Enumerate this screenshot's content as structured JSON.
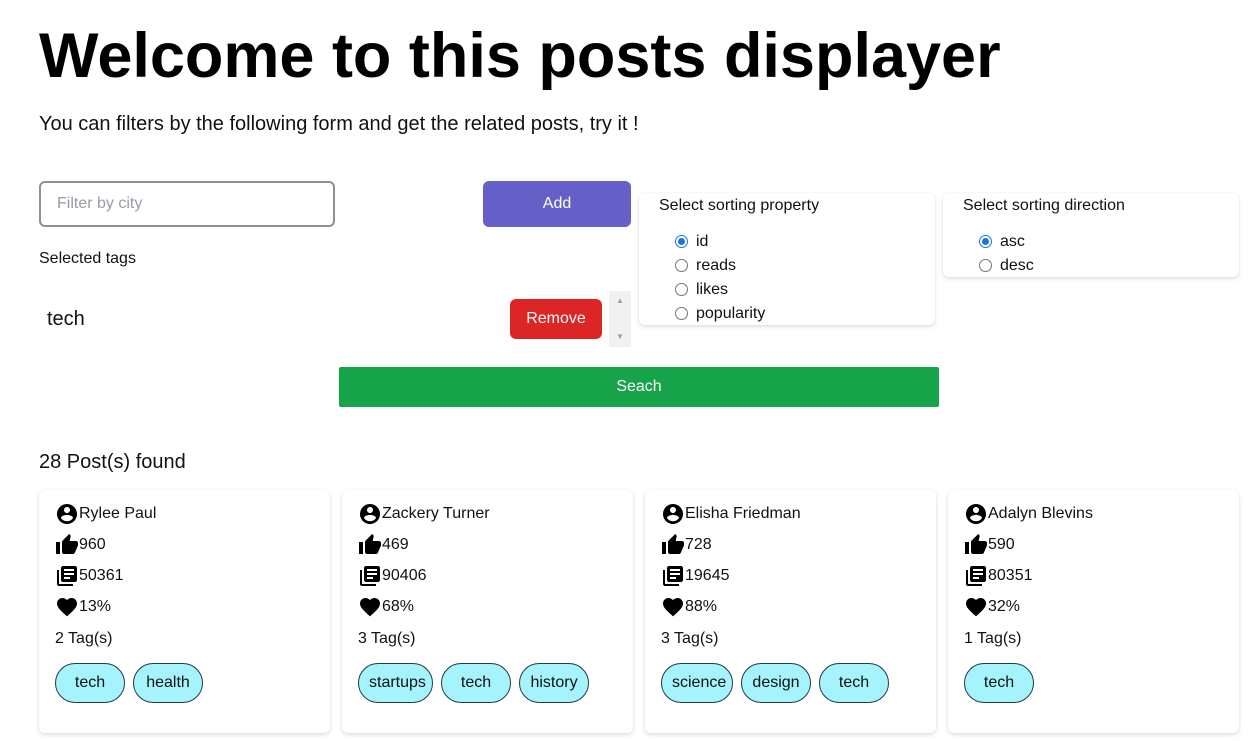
{
  "header": {
    "title": "Welcome to this posts displayer",
    "subtitle": "You can filters by the following form and get the related posts, try it !"
  },
  "filter": {
    "city_placeholder": "Filter by city",
    "add_label": "Add",
    "selected_tags_label": "Selected tags",
    "selected_tags": [
      {
        "name": "tech",
        "remove_label": "Remove"
      }
    ]
  },
  "sort_property": {
    "title": "Select sorting property",
    "options": [
      "id",
      "reads",
      "likes",
      "popularity"
    ],
    "selected": "id"
  },
  "sort_direction": {
    "title": "Select sorting direction",
    "options": [
      "asc",
      "desc"
    ],
    "selected": "asc"
  },
  "search_label": "Seach",
  "results": {
    "count_text": "28 Post(s) found",
    "posts": [
      {
        "author": "Rylee Paul",
        "likes": "960",
        "reads": "50361",
        "popularity": "13%",
        "tag_count": "2 Tag(s)",
        "tags": [
          "tech",
          "health"
        ]
      },
      {
        "author": "Zackery Turner",
        "likes": "469",
        "reads": "90406",
        "popularity": "68%",
        "tag_count": "3 Tag(s)",
        "tags": [
          "startups",
          "tech",
          "history"
        ]
      },
      {
        "author": "Elisha Friedman",
        "likes": "728",
        "reads": "19645",
        "popularity": "88%",
        "tag_count": "3 Tag(s)",
        "tags": [
          "science",
          "design",
          "tech"
        ]
      },
      {
        "author": "Adalyn Blevins",
        "likes": "590",
        "reads": "80351",
        "popularity": "32%",
        "tag_count": "1 Tag(s)",
        "tags": [
          "tech"
        ]
      }
    ]
  },
  "icons": {
    "author": "account-circle-icon",
    "likes": "thumb-up-icon",
    "reads": "library-books-icon",
    "popularity": "heart-icon"
  },
  "colors": {
    "add": "#6460c8",
    "remove": "#dc2626",
    "search": "#16a34a",
    "chip": "#a5f3fc",
    "radio": "#1a73e8"
  }
}
